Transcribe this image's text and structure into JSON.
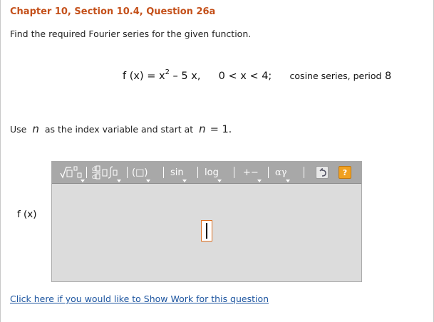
{
  "header": {
    "title": "Chapter 10, Section 10.4, Question 26a"
  },
  "question": {
    "instruction": "Find the required Fourier series for the given function.",
    "formula": {
      "lhs": "f (x) = x",
      "exponent": "2",
      "rhs": " – 5 x,",
      "domain": "0 < x < 4;",
      "series_type": "cosine series, period",
      "period": "8"
    },
    "index_note": {
      "prefix": "Use",
      "variable": "n",
      "middle": "as the index variable and start at",
      "variable2": "n",
      "start": "= 1."
    }
  },
  "answer": {
    "label": "f (x)",
    "toolbar": {
      "templates_icon": "sqrt-superscript-icon",
      "calculus_icon": "derivative-icon",
      "brackets_label": "(□)",
      "trig_label": "sin",
      "log_label": "log",
      "operators_label": "+−",
      "greek_label": "αγ",
      "undo_icon": "undo-icon",
      "help_label": "?"
    }
  },
  "footer": {
    "show_work_link": "Click here if you would like to Show Work for this question"
  }
}
